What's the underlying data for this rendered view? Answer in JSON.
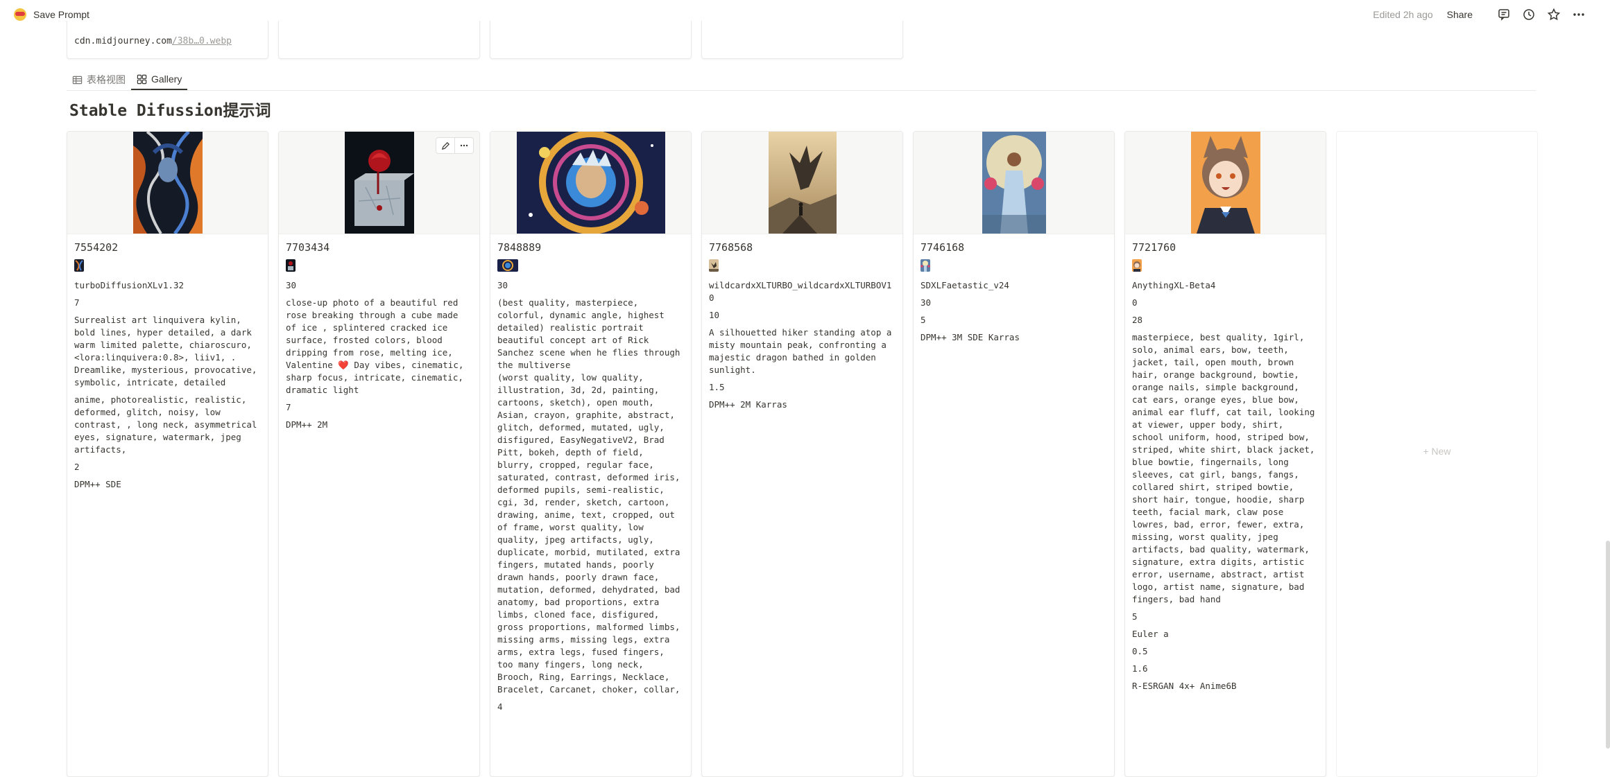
{
  "app": {
    "title": "Save Prompt"
  },
  "topbar": {
    "edited": "Edited 2h ago",
    "share": "Share"
  },
  "top_cards": {
    "url_main": "cdn.midjourney.com",
    "url_dim": "/38b…0.webp"
  },
  "views": [
    {
      "label": "表格视图"
    },
    {
      "label": "Gallery"
    }
  ],
  "database": {
    "title": "Stable Difussion提示词"
  },
  "new_label": "+ New",
  "cards": [
    {
      "id": "7554202",
      "props": [
        "turboDiffusionXLv1.32",
        "7",
        "Surrealist art linquivera kylin, bold lines, hyper detailed, a dark warm limited palette, chiaroscuro, <lora:linquivera:0.8>, liiv1, . Dreamlike, mysterious, provocative, symbolic, intricate, detailed",
        "anime, photorealistic, realistic, deformed, glitch, noisy, low contrast, , long neck, asymmetrical eyes, signature, watermark, jpeg artifacts,",
        "2",
        "DPM++ SDE"
      ]
    },
    {
      "id": "7703434",
      "props": [
        "30",
        "close-up photo of a beautiful red rose breaking through a cube made of ice , splintered cracked ice surface, frosted colors, blood dripping from rose, melting ice, Valentine ❤️ Day vibes, cinematic, sharp focus, intricate, cinematic, dramatic light",
        "7",
        "DPM++ 2M"
      ]
    },
    {
      "id": "7848889",
      "props": [
        "30",
        "(best quality, masterpiece, colorful, dynamic angle, highest detailed) realistic portrait beautiful concept art of Rick Sanchez scene when he flies through the multiverse",
        "(worst quality, low quality, illustration, 3d, 2d, painting, cartoons, sketch), open mouth, Asian, crayon, graphite, abstract, glitch, deformed, mutated, ugly, disfigured, EasyNegativeV2, Brad Pitt, bokeh, depth of field, blurry, cropped, regular face, saturated, contrast, deformed iris, deformed pupils, semi-realistic, cgi, 3d, render, sketch, cartoon, drawing, anime, text, cropped, out of frame, worst quality, low quality, jpeg artifacts, ugly, duplicate, morbid, mutilated, extra fingers, mutated hands, poorly drawn hands, poorly drawn face, mutation, deformed, dehydrated, bad anatomy, bad proportions, extra limbs, cloned face, disfigured, gross proportions, malformed limbs, missing arms, missing legs, extra arms, extra legs, fused fingers, too many fingers, long neck, Brooch, Ring, Earrings, Necklace, Bracelet, Carcanet, choker, collar,",
        "4"
      ]
    },
    {
      "id": "7768568",
      "props": [
        "wildcardxXLTURBO_wildcardxXLTURBOV10",
        "10",
        "A silhouetted hiker standing atop a misty mountain peak, confronting a majestic dragon bathed in golden sunlight.",
        "1.5",
        "DPM++ 2M Karras"
      ]
    },
    {
      "id": "7746168",
      "props": [
        "SDXLFaetastic_v24",
        "30",
        "5",
        "DPM++ 3M SDE Karras"
      ]
    },
    {
      "id": "7721760",
      "props": [
        "AnythingXL-Beta4",
        "0",
        "28",
        "masterpiece, best quality, 1girl, solo, animal ears, bow, teeth, jacket, tail, open mouth, brown hair, orange background, bowtie, orange nails, simple background, cat ears, orange eyes, blue bow, animal ear fluff, cat tail, looking at viewer, upper body, shirt, school uniform, hood, striped bow, striped, white shirt, black jacket, blue bowtie, fingernails, long sleeves, cat girl, bangs, fangs, collared shirt, striped bowtie, short hair, tongue, hoodie, sharp teeth, facial mark, claw pose",
        "lowres, bad, error, fewer, extra, missing, worst quality, jpeg artifacts, bad quality, watermark, signature, extra digits, artistic error, username, abstract, artist logo, artist name, signature, bad fingers, bad hand",
        "5",
        "Euler a",
        "0.5",
        "1.6",
        "R-ESRGAN 4x+ Anime6B"
      ]
    }
  ]
}
